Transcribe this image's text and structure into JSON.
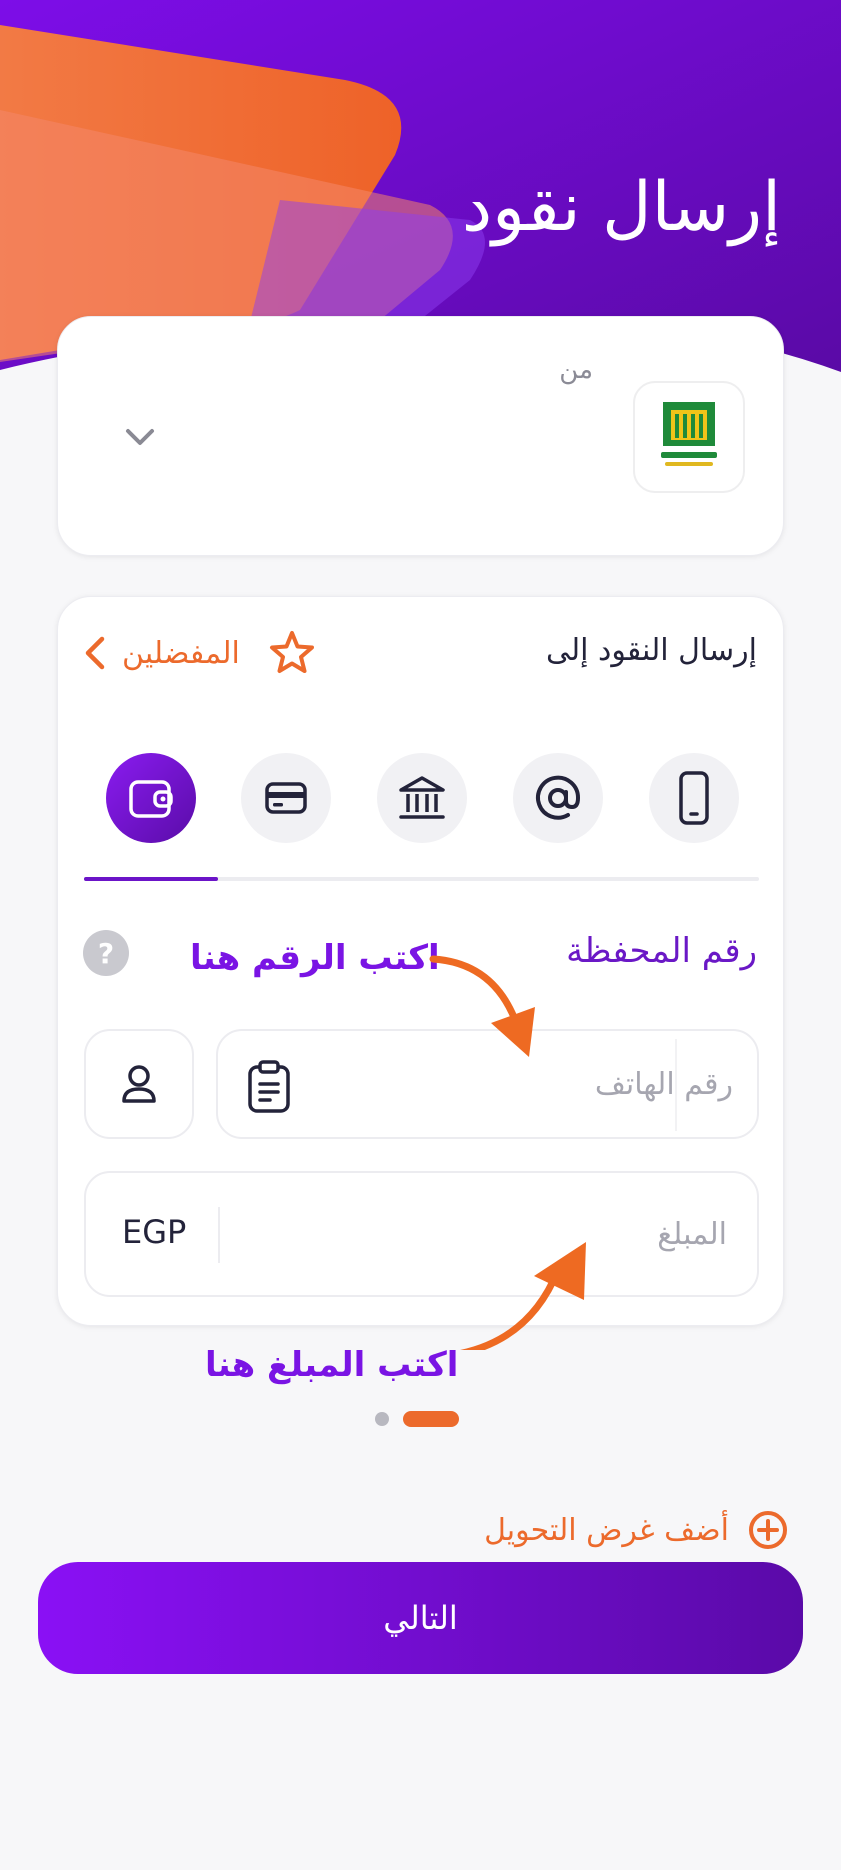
{
  "header": {
    "title": "إرسال نقود"
  },
  "from_section": {
    "label": "من",
    "bank_logo_icon": "national-bank-of-egypt-logo",
    "dropdown_icon": "chevron-down-icon"
  },
  "send_section": {
    "send_to_label": "إرسال النقود إلى",
    "favorites_label": "المفضلين",
    "transfer_types": [
      {
        "icon": "phone-icon",
        "active": false
      },
      {
        "icon": "at-sign-icon",
        "active": false
      },
      {
        "icon": "bank-icon",
        "active": false
      },
      {
        "icon": "card-icon",
        "active": false
      },
      {
        "icon": "wallet-icon",
        "active": true
      }
    ],
    "wallet_number_label": "رقم المحفظة",
    "help_icon_text": "?",
    "phone_placeholder": "رقم الهاتف",
    "amount_placeholder": "المبلغ",
    "currency": "EGP"
  },
  "annotations": {
    "write_number_here": "اكتب الرقم هنا",
    "write_amount_here": "اكتب المبلغ هنا"
  },
  "pager": {
    "page_count": 2,
    "active_page": 2
  },
  "add_purpose_label": "أضف غرض التحويل",
  "next_button_label": "التالي",
  "colors": {
    "primary_purple": "#7a14e4",
    "accent_orange": "#ec6a2c",
    "text_dark": "#23233a",
    "placeholder_gray": "#a6a6b0"
  }
}
